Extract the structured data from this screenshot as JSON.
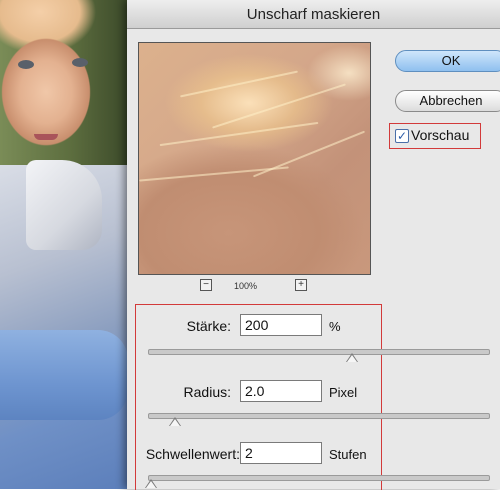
{
  "dialog": {
    "title": "Unscharf maskieren",
    "ok_label": "OK",
    "cancel_label": "Abbrechen",
    "preview_label": "Vorschau",
    "preview_checked": true
  },
  "zoom": {
    "minus_icon": "minus-icon",
    "plus_icon": "plus-icon",
    "minus_glyph": "−",
    "plus_glyph": "+",
    "value": "100%"
  },
  "params": {
    "amount": {
      "label": "Stärke:",
      "value": "200",
      "unit": "%",
      "slider_level": 0.6
    },
    "radius": {
      "label": "Radius:",
      "value": "2.0",
      "unit": "Pixel",
      "slider_level": 0.08
    },
    "threshold": {
      "label": "Schwellenwert:",
      "value": "2",
      "unit": "Stufen",
      "slider_level": 0.01
    }
  },
  "colors": {
    "highlight": "#d23a3a",
    "ok_button": "#8fc0ef",
    "selection": "#b5d5ff"
  }
}
